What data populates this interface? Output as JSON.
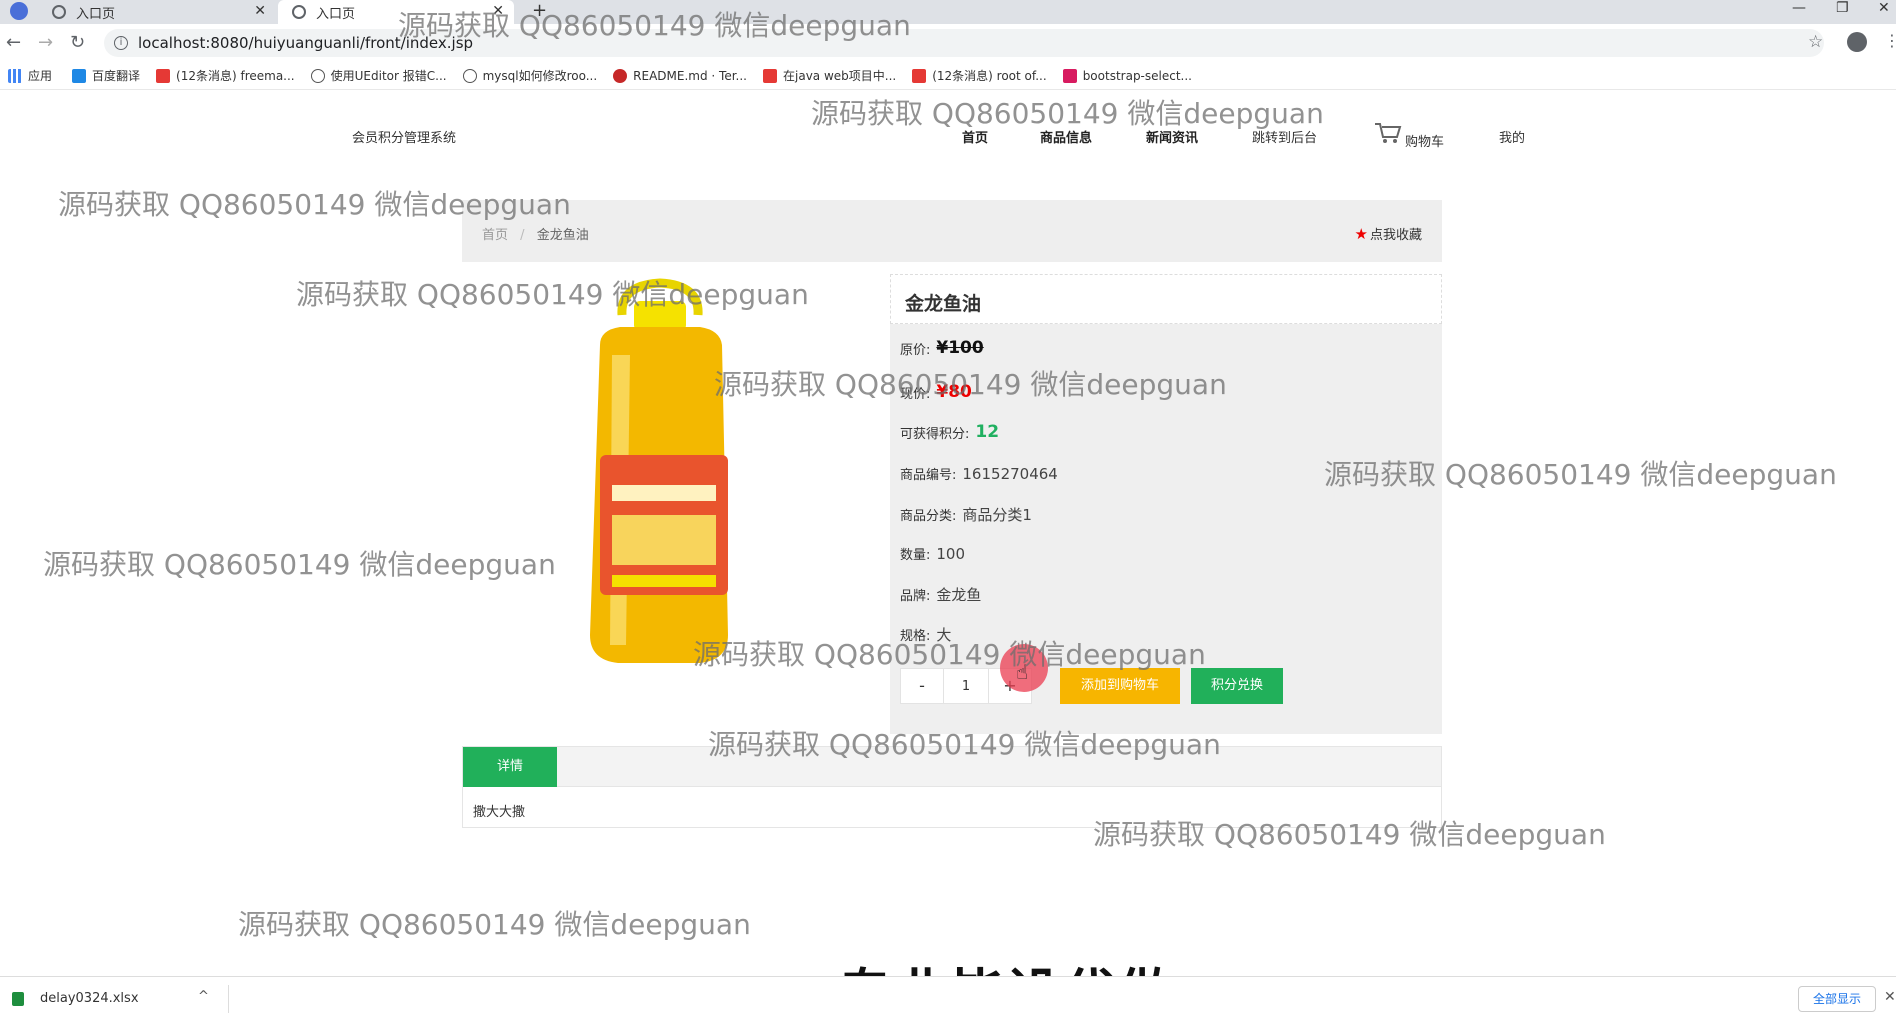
{
  "browser": {
    "tabs": [
      {
        "label": "入口页"
      },
      {
        "label": "入口页"
      }
    ],
    "new_tab": "+",
    "url": "localhost:8080/huiyuanguanli/front/index.jsp",
    "bookmarks": [
      {
        "label": "应用",
        "icon": "apps-grid-icon"
      },
      {
        "label": "百度翻译",
        "icon": "baidu-translate-icon"
      },
      {
        "label": "(12条消息) freema...",
        "icon": "csdn-icon"
      },
      {
        "label": "使用UEditor 报错C...",
        "icon": "link-icon"
      },
      {
        "label": "mysql如何修改roo...",
        "icon": "link-icon"
      },
      {
        "label": "README.md · Ter...",
        "icon": "gitee-icon"
      },
      {
        "label": "在java web项目中...",
        "icon": "csdn-icon"
      },
      {
        "label": "(12条消息) root of...",
        "icon": "csdn-icon"
      },
      {
        "label": "bootstrap-select...",
        "icon": "bookmark-icon"
      }
    ]
  },
  "site": {
    "title": "会员积分管理系统",
    "nav": [
      {
        "label": "首页"
      },
      {
        "label": "商品信息"
      },
      {
        "label": "新闻资讯"
      },
      {
        "label": "跳转到后台"
      },
      {
        "label": "购物车"
      },
      {
        "label": "我的"
      }
    ]
  },
  "breadcrumb": {
    "home": "首页",
    "separator": "/",
    "current": "金龙鱼油",
    "favorite": "点我收藏"
  },
  "product": {
    "name": "金龙鱼油",
    "fields": [
      {
        "label": "原价:",
        "value": "¥100"
      },
      {
        "label": "现价:",
        "value": "¥80"
      },
      {
        "label": "可获得积分:",
        "value": "12"
      },
      {
        "label": "商品编号:",
        "value": "1615270464"
      },
      {
        "label": "商品分类:",
        "value": "商品分类1"
      },
      {
        "label": "数量:",
        "value": "100"
      },
      {
        "label": "品牌:",
        "value": "金龙鱼"
      },
      {
        "label": "规格:",
        "value": "大"
      }
    ],
    "quantity": {
      "minus": "-",
      "value": "1",
      "plus": "+"
    },
    "add_to_cart": "添加到购物车",
    "exchange": "积分兑换"
  },
  "detail": {
    "tab_label": "详情",
    "content": "撒大大撒"
  },
  "watermark": "源码获取 QQ86050149 微信deepguan",
  "overlay_text": "专业毕设代做",
  "download_bar": {
    "file_name": "delay0324.xlsx",
    "show_all": "全部显示"
  },
  "colors": {
    "accent_green": "#21b05a",
    "cart_yellow": "#f7b500",
    "price_red": "#e00000",
    "points_green": "#20b060"
  }
}
